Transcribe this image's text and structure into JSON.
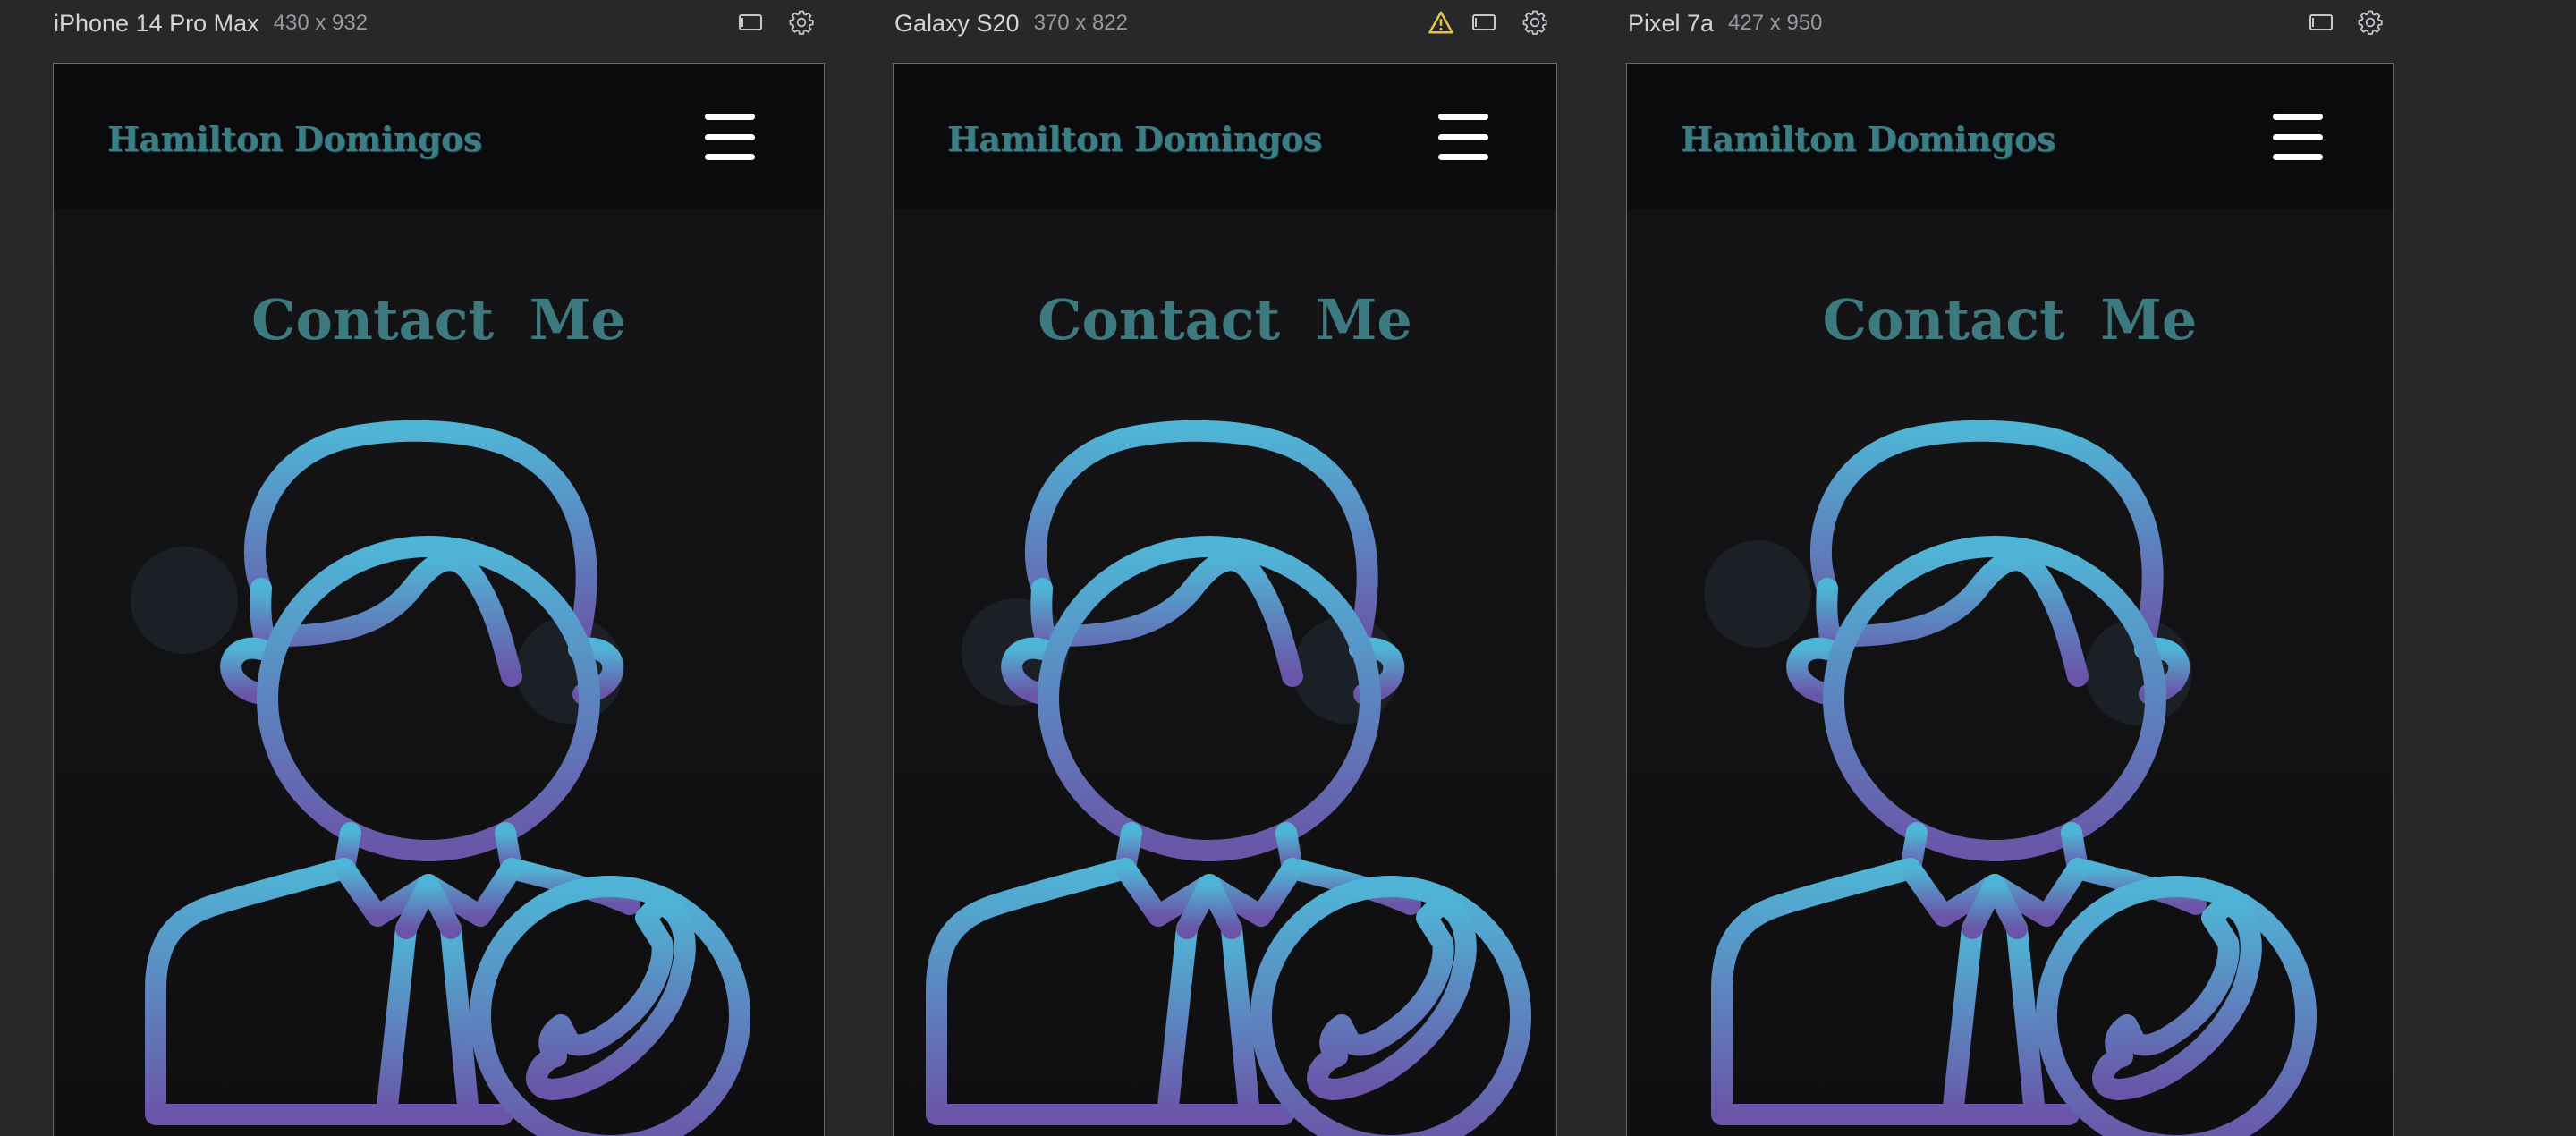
{
  "devices": [
    {
      "name": "iPhone 14 Pro Max",
      "size": "430 x 932",
      "warning": false
    },
    {
      "name": "Galaxy S20",
      "size": "370 x 822",
      "warning": true
    },
    {
      "name": "Pixel 7a",
      "size": "427 x 950",
      "warning": false
    }
  ],
  "page": {
    "brand": "Hamilton Domingos",
    "title": "Contact  Me"
  },
  "colors": {
    "background": "#28282b",
    "brand_text": "#3c7e85",
    "gradient_top": "#4fb5d6",
    "gradient_bottom": "#6a55a8",
    "warning": "#e7c24a"
  },
  "icons": [
    "viewport-icon",
    "settings-icon",
    "warning-icon",
    "menu-icon",
    "contact-person-phone-illustration"
  ]
}
